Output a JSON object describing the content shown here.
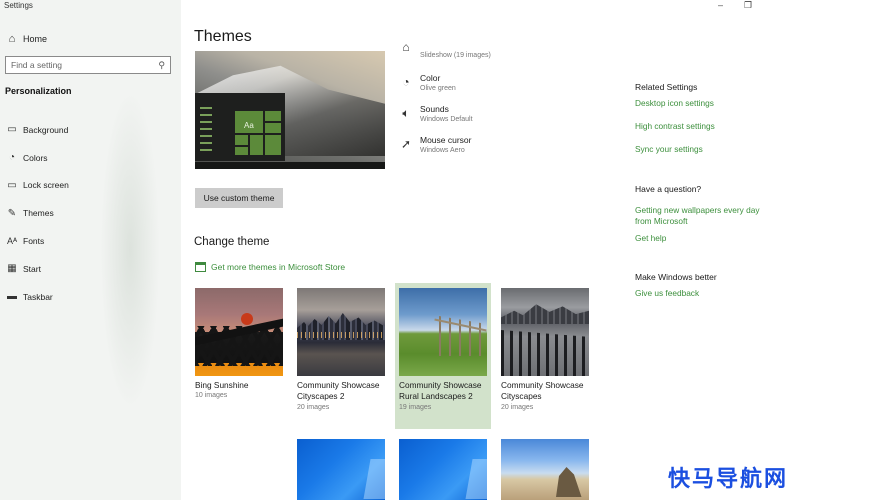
{
  "window": {
    "title": "Settings",
    "minimize": "–",
    "restore": "❐"
  },
  "sidebar": {
    "home_label": "Home",
    "search_placeholder": "Find a setting",
    "section_title": "Personalization",
    "items": [
      {
        "label": "Background",
        "icon": "picture-icon"
      },
      {
        "label": "Colors",
        "icon": "palette-icon"
      },
      {
        "label": "Lock screen",
        "icon": "lock-screen-icon"
      },
      {
        "label": "Themes",
        "icon": "brush-icon"
      },
      {
        "label": "Fonts",
        "icon": "font-icon"
      },
      {
        "label": "Start",
        "icon": "start-icon"
      },
      {
        "label": "Taskbar",
        "icon": "taskbar-icon"
      }
    ]
  },
  "main": {
    "title": "Themes",
    "preview": {
      "tile_label": "Aa"
    },
    "properties": [
      {
        "title": "",
        "subtitle": "Slideshow (19 images)",
        "icon": "picture-icon"
      },
      {
        "title": "Color",
        "subtitle": "Olive green",
        "icon": "palette-icon"
      },
      {
        "title": "Sounds",
        "subtitle": "Windows Default",
        "icon": "speaker-icon"
      },
      {
        "title": "Mouse cursor",
        "subtitle": "Windows Aero",
        "icon": "cursor-icon"
      }
    ],
    "custom_theme_button": "Use custom theme",
    "change_theme_title": "Change theme",
    "store_link": "Get more themes in Microsoft Store",
    "themes": [
      {
        "name": "Bing Sunshine",
        "count": "10 images",
        "selected": false
      },
      {
        "name": "Community Showcase Cityscapes 2",
        "count": "20 images",
        "selected": false
      },
      {
        "name": "Community Showcase Rural Landscapes 2",
        "count": "19 images",
        "selected": true
      },
      {
        "name": "Community Showcase Cityscapes",
        "count": "20 images",
        "selected": false
      },
      {
        "name": "",
        "count": "",
        "selected": false
      },
      {
        "name": "",
        "count": "",
        "selected": false
      },
      {
        "name": "",
        "count": "",
        "selected": false
      }
    ]
  },
  "related": {
    "heading": "Related Settings",
    "links": [
      "Desktop icon settings",
      "High contrast settings",
      "Sync your settings"
    ],
    "question_heading": "Have a question?",
    "question_links": [
      "Getting new wallpapers every day from Microsoft",
      "Get help"
    ],
    "better_heading": "Make Windows better",
    "better_link": "Give us feedback"
  },
  "watermark": "快马导航网",
  "colors": {
    "accent": "#3c8f3c",
    "selected_tile": "#d2e2cb",
    "sidebar_bg": "#f2f4f2"
  }
}
